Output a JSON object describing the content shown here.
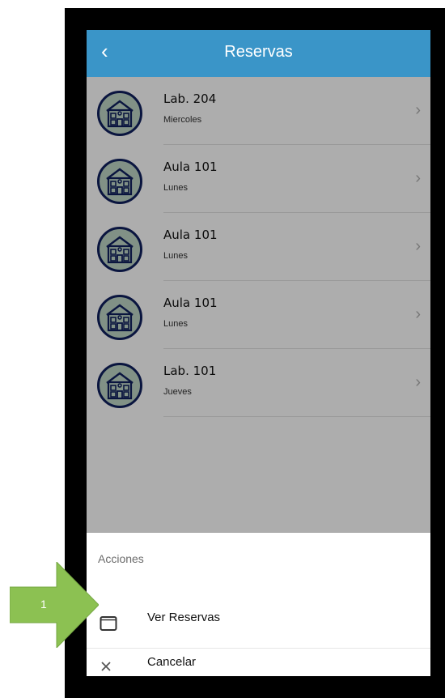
{
  "header": {
    "back_icon": "chevron-left-icon",
    "title": "Reservas",
    "color": "#3a95c8"
  },
  "list": {
    "items": [
      {
        "title": "Lab. 204",
        "subtitle": "Miercoles",
        "icon": "building-icon"
      },
      {
        "title": "Aula 101",
        "subtitle": "Lunes",
        "icon": "building-icon"
      },
      {
        "title": "Aula 101",
        "subtitle": "Lunes",
        "icon": "building-icon"
      },
      {
        "title": "Aula 101",
        "subtitle": "Lunes",
        "icon": "building-icon"
      },
      {
        "title": "Lab. 101",
        "subtitle": "Jueves",
        "icon": "building-icon"
      }
    ],
    "chevron": "›"
  },
  "action_sheet": {
    "title": "Acciones",
    "actions": [
      {
        "label": "Ver Reservas",
        "icon": "square-icon"
      },
      {
        "label": "Cancelar",
        "icon": "close-icon"
      }
    ]
  },
  "callout": {
    "label": "1",
    "color": "#8cc152"
  }
}
